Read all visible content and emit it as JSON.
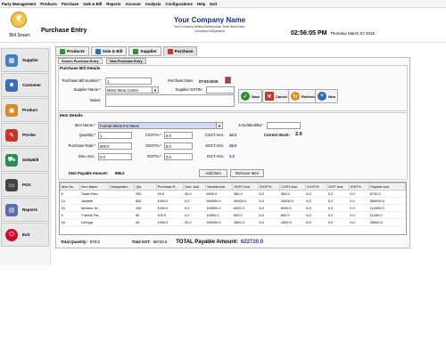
{
  "menu": [
    "Party Management",
    "Products",
    "Purchase",
    "Sale & Bill",
    "Reports",
    "Account",
    "Analysis",
    "Configurations",
    "Help",
    "Exit"
  ],
  "logo": {
    "letter": "₹",
    "text": "Bill Smart"
  },
  "page_title": "Purchase Entry",
  "company": {
    "name": "Your Company Name",
    "address": "Your Company Adress,Kanchipuram,Tamil Nadu,India.",
    "email": "Company123@gmail.in"
  },
  "clock": "02:56:05 PM",
  "date": "Thursday    March 07 2019",
  "sidebar": [
    {
      "label": "Supplier",
      "icon": "supplier-icon"
    },
    {
      "label": "Customer",
      "icon": "customer-icon"
    },
    {
      "label": "Product",
      "icon": "product-icon"
    },
    {
      "label": "POrder",
      "icon": "porder-icon"
    },
    {
      "label": "Sell&Bill",
      "icon": "cart-icon"
    },
    {
      "label": "POS",
      "icon": "pos-icon"
    },
    {
      "label": "Reports",
      "icon": "reports-icon"
    },
    {
      "label": "Exit",
      "icon": "power-icon"
    }
  ],
  "tabs": [
    "Products",
    "Sale & Bill",
    "Supplier",
    "Purchase"
  ],
  "subtabs": [
    "Search Purchase Entry",
    "New Purchase Entry"
  ],
  "bill_details": {
    "title": "Purchase Bill Details",
    "bill_no_label": "Purchase Bill Number:*",
    "bill_no": "1",
    "date_label": "Purchase Date:",
    "date": "07-03-2019",
    "supplier_label": "Supplier Name:*",
    "supplier": "Mens Wear Centre",
    "gst_label": "Supplier GSTIN:",
    "gst": "",
    "notes_label": "Notes:",
    "notes": ""
  },
  "actions": [
    "Save",
    "Cancel",
    "Refresh",
    "New"
  ],
  "item_details": {
    "title": "Item Details",
    "item_label": "Item Name:*",
    "item": "Formal Shirts For Mens",
    "sno_label": "S.No/Identifier:",
    "sno": "",
    "qty_label": "Quantity:*",
    "qty": "1",
    "rate_label": "Purchase Rate:*",
    "rate": "800.0",
    "disc_label": "Disc.Amt.:",
    "disc": "0.0",
    "cgst_label": "CGST%:*",
    "cgst": "6.0",
    "sgst_label": "SGST%:*",
    "sgst": "6.0",
    "igst_label": "IGST%:*",
    "igst": "0.0",
    "cgst_amt_label": "CGST Amt.",
    "cgst_amt": "48.0",
    "sgst_amt_label": "SGST Amt.",
    "sgst_amt": "48.0",
    "igst_amt_label": "IGST Amt.",
    "igst_amt": "0.0",
    "stock_label": "Current Stock:",
    "stock": "2.0",
    "payable_label": "Item Payable Amount:",
    "payable": "896.0",
    "add_label": "Add Item",
    "remove_label": "Remove Item"
  },
  "table": {
    "columns": [
      "Item No.",
      "Item Name",
      "Uniqueiden...",
      "Qty",
      "Purchase R...",
      "Disc. Amt.",
      "Taxable Amt.",
      "SGST Amt.",
      "SGST%",
      "CGST Amt.",
      "CGST%",
      "IGST Amt.",
      "IGST%",
      "Payable Amt."
    ],
    "rows": [
      [
        "8",
        "Towel Ren...",
        "",
        "200",
        "30.0",
        "20.0",
        "6000.0",
        "360.0",
        "6.0",
        "360.0",
        "6.0",
        "0.0",
        "0.0",
        "6720.0"
      ],
      [
        "13",
        "Jackets",
        "",
        "500",
        "1000.0",
        "0.0",
        "500000.0",
        "30000.0",
        "6.0",
        "30000.0",
        "6.0",
        "0.0",
        "0.0",
        "560000.0"
      ],
      [
        "15",
        "Women Je...",
        "",
        "100",
        "1000.0",
        "0.0",
        "100000.0",
        "6000.0",
        "6.0",
        "6000.0",
        "6.0",
        "0.0",
        "0.0",
        "112000.0"
      ],
      [
        "4",
        "T-shirts For...",
        "",
        "50",
        "200.0",
        "0.0",
        "10000.0",
        "600.0",
        "6.0",
        "600.0",
        "6.0",
        "0.0",
        "0.0",
        "11200.0"
      ],
      [
        "16",
        "Lehnga",
        "",
        "20",
        "1000.0",
        "20.0",
        "300000.0",
        "1800.0",
        "6.0",
        "1800.0",
        "6.0",
        "0.0",
        "0.0",
        "33600.0"
      ]
    ]
  },
  "totals": {
    "qty_label": "Total Quantity:",
    "qty": "870.0",
    "gst_label": "Total GST:",
    "gst": "66720.0",
    "pay_label": "TOTAL Payable Amount:",
    "pay": "622720.0"
  }
}
